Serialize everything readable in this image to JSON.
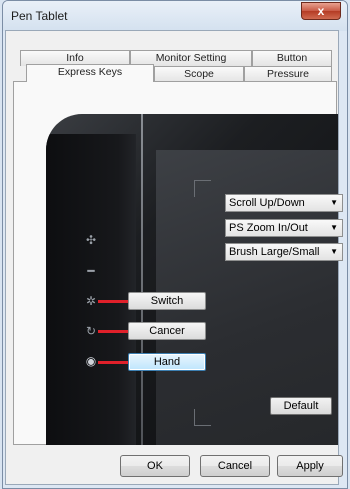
{
  "window": {
    "title": "Pen Tablet",
    "close_glyph": "x"
  },
  "tabs": {
    "row_back": [
      "Info",
      "Monitor Setting",
      "Button"
    ],
    "row_front": [
      "Express Keys",
      "Scope",
      "Pressure"
    ],
    "active": "Express Keys"
  },
  "touch_strip_icons": [
    "zoom-in-icon",
    "zoom-out-icon",
    "brightness-icon",
    "rotate-icon",
    "mouse-icon"
  ],
  "express_keys": [
    {
      "label": "Switch",
      "selected": false
    },
    {
      "label": "Cancer",
      "selected": false
    },
    {
      "label": "Hand",
      "selected": true
    }
  ],
  "dropdowns": [
    {
      "value": "Scroll Up/Down"
    },
    {
      "value": "PS Zoom In/Out"
    },
    {
      "value": "Brush Large/Small"
    }
  ],
  "default_label": "Default",
  "footer": {
    "ok": "OK",
    "cancel": "Cancel",
    "apply": "Apply"
  },
  "colors": {
    "accent_red": "#e0202a",
    "tablet_body": "#1c1e21",
    "selected_blue": "#bee6fd"
  }
}
